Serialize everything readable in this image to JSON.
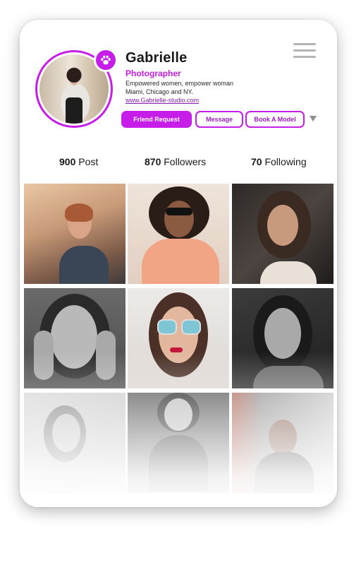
{
  "profile": {
    "name": "Gabrielle",
    "role": "Photographer",
    "bio_line1": "Empowered women, empower woman",
    "bio_line2": "Miami, Chicago and NY.",
    "website": "www.Gabrielle-studio.com"
  },
  "actions": {
    "friend_request": "Friend Request",
    "message": "Message",
    "book_model": "Book A Model"
  },
  "stats": {
    "posts_count": "900",
    "posts_label": "Post",
    "followers_count": "870",
    "followers_label": "Followers",
    "following_count": "70",
    "following_label": "Following"
  },
  "colors": {
    "accent": "#c61de8",
    "text": "#1a1a1a",
    "menu": "#b4b4b4"
  },
  "icons": {
    "menu": "hamburger-menu-icon",
    "badge": "paw-icon",
    "dropdown": "caret-down-icon"
  }
}
